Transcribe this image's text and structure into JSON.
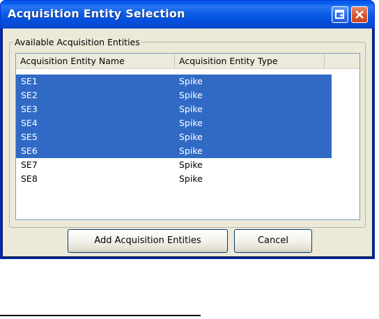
{
  "window": {
    "title": "Acquisition Entity Selection"
  },
  "groupbox": {
    "legend": "Available Acquisition Entities"
  },
  "list": {
    "columns": [
      "Acquisition Entity Name",
      "Acquisition Entity Type",
      ""
    ],
    "rows": [
      {
        "name": "SE1",
        "type": "Spike",
        "selected": true
      },
      {
        "name": "SE2",
        "type": "Spike",
        "selected": true
      },
      {
        "name": "SE3",
        "type": "Spike",
        "selected": true
      },
      {
        "name": "SE4",
        "type": "Spike",
        "selected": true
      },
      {
        "name": "SE5",
        "type": "Spike",
        "selected": true
      },
      {
        "name": "SE6",
        "type": "Spike",
        "selected": true
      },
      {
        "name": "SE7",
        "type": "Spike",
        "selected": false
      },
      {
        "name": "SE8",
        "type": "Spike",
        "selected": false
      }
    ]
  },
  "buttons": {
    "add_label": "Add Acquisition Entities",
    "cancel_label": "Cancel"
  },
  "icons": {
    "restore": "restore-icon",
    "close": "close-icon"
  },
  "colors": {
    "selection": "#316ac5",
    "titlebar": "#0058ee"
  }
}
